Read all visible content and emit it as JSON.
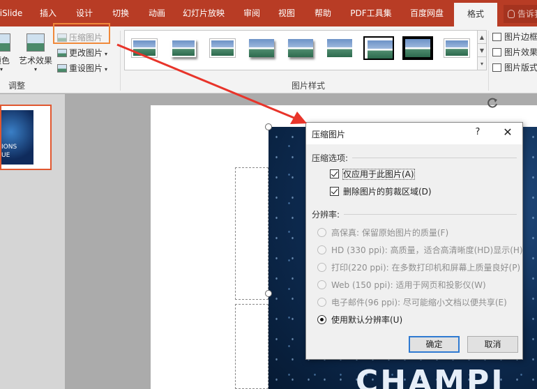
{
  "tabs": [
    {
      "label": "iSlide"
    },
    {
      "label": "插入"
    },
    {
      "label": "设计"
    },
    {
      "label": "切换"
    },
    {
      "label": "动画"
    },
    {
      "label": "幻灯片放映"
    },
    {
      "label": "审阅"
    },
    {
      "label": "视图"
    },
    {
      "label": "帮助"
    },
    {
      "label": "PDF工具集"
    },
    {
      "label": "百度网盘"
    },
    {
      "label": "格式"
    }
  ],
  "tell_me": "告诉我",
  "ribbon": {
    "adjust": {
      "color_label": "颜色",
      "artistic_label": "艺术效果",
      "compress_label": "压缩图片",
      "change_label": "更改图片",
      "reset_label": "重设图片",
      "group_label": "调整"
    },
    "styles": {
      "group_label": "图片样式"
    },
    "right": {
      "border_label": "图片边框",
      "effects_label": "图片效果",
      "layout_label": "图片版式"
    }
  },
  "slide_thumb": {
    "line1": "IONS",
    "line2": "UE"
  },
  "picture_text": "CHAMPI",
  "dialog": {
    "title": "压缩图片",
    "help": "?",
    "close": "✕",
    "compress_options_label": "压缩选项:",
    "apply_only": "仅应用于此图片(A)",
    "delete_cropped": "删除图片的剪裁区域(D)",
    "resolution_label": "分辨率:",
    "resolutions": [
      {
        "label": "高保真: 保留原始图片的质量(F)",
        "enabled": false,
        "checked": false
      },
      {
        "label": "HD (330 ppi): 高质量，适合高清晰度(HD)显示(H)",
        "enabled": false,
        "checked": false
      },
      {
        "label": "打印(220 ppi): 在多数打印机和屏幕上质量良好(P)",
        "enabled": false,
        "checked": false
      },
      {
        "label": "Web (150 ppi): 适用于网页和投影仪(W)",
        "enabled": false,
        "checked": false
      },
      {
        "label": "电子邮件(96 ppi): 尽可能缩小文档以便共享(E)",
        "enabled": false,
        "checked": false
      },
      {
        "label": "使用默认分辨率(U)",
        "enabled": true,
        "checked": true
      }
    ],
    "ok": "确定",
    "cancel": "取消"
  },
  "colors": {
    "tab_bar": "#b83c25",
    "highlight": "#f0893a",
    "arrow": "#e8342a",
    "default_button_border": "#2f7ad1"
  }
}
